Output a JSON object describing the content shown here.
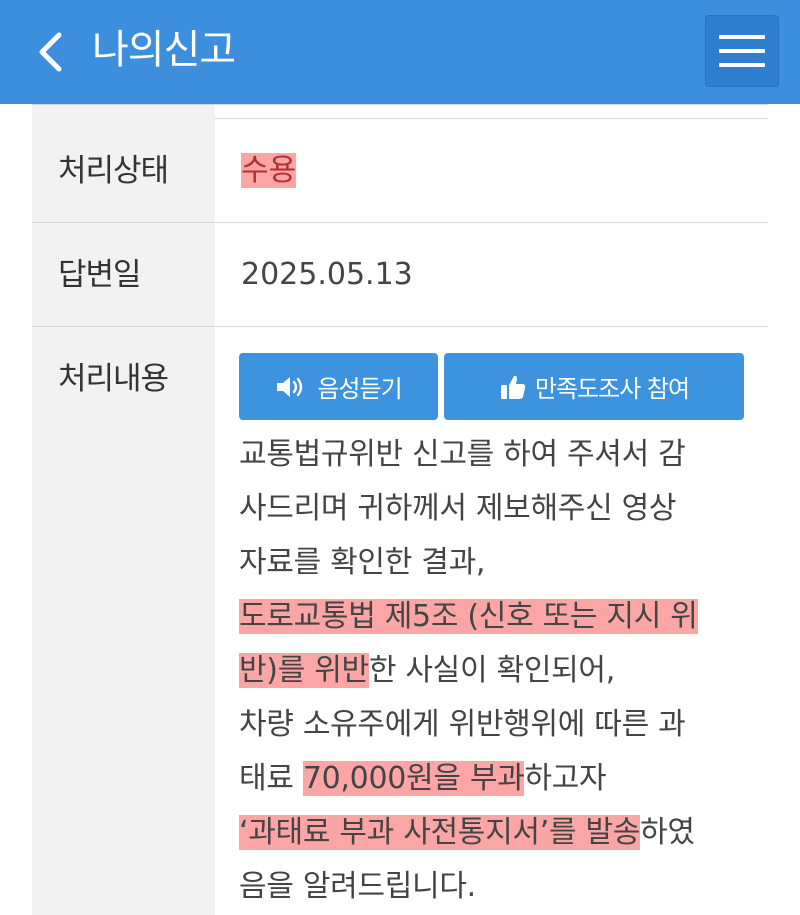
{
  "header": {
    "title": "나의신고",
    "back_icon": "chevron-left-icon",
    "menu_icon": "hamburger-menu-icon",
    "background_color": "#3d8fde"
  },
  "rows": {
    "status": {
      "label": "처리상태",
      "value": "수용"
    },
    "date": {
      "label": "답변일",
      "value": "2025.05.13"
    },
    "content": {
      "label": "처리내용",
      "buttons": {
        "voice": {
          "label": "음성듣기",
          "icon": "speaker-icon"
        },
        "survey": {
          "label": "만족도조사 참여",
          "icon": "thumbs-up-icon"
        }
      },
      "lines": {
        "l1": "교통법규위반 신고를 하여 주셔서 감",
        "l2": "사드리며 귀하께서 제보해주신 영상",
        "l3": "자료를 확인한 결과,",
        "l4": "도로교통법 제5조 (신호 또는 지시 위",
        "l5_hl": "반)를 위반",
        "l5_rest": "한 사실이 확인되어,",
        "l6": "차량 소유주에게 위반행위에 따른 과",
        "l7_pre": "태료 ",
        "l7_hl": "70,000원을 부과",
        "l7_rest": "하고자",
        "l8_hl": "‘과태료 부과 사전통지서’를 발송",
        "l8_rest": "하였",
        "l9": "음을 알려드립니다."
      }
    }
  },
  "colors": {
    "highlight": "#fa6e6e",
    "button": "#3d93dd",
    "label_bg": "#f2f2f2"
  }
}
